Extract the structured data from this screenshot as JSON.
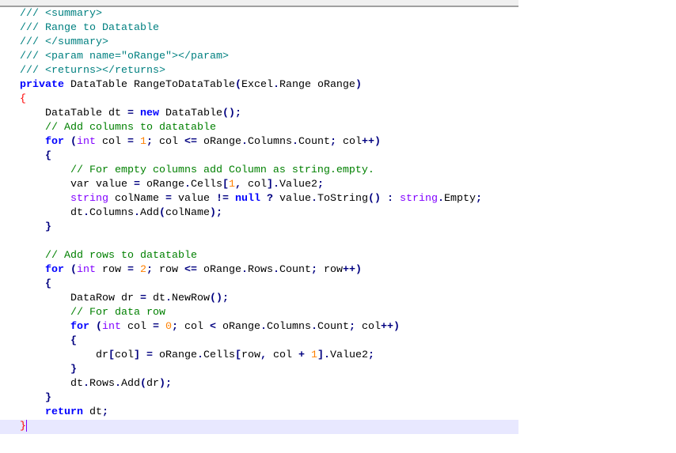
{
  "editor": {
    "current_line": 30,
    "colors": {
      "doc_comment": "#008080",
      "comment": "#008000",
      "keyword": "#0000FF",
      "type": "#8000FF",
      "number": "#FF8000",
      "operator": "#000080",
      "brace_match": "#FF0000",
      "current_line_bg": "#E8E8FF"
    },
    "lines": [
      [
        [
          "/// <summary>",
          "d"
        ]
      ],
      [
        [
          "/// Range to Datatable",
          "d"
        ]
      ],
      [
        [
          "/// </summary>",
          "d"
        ]
      ],
      [
        [
          "/// <param name=\"oRange\"></param>",
          "d"
        ]
      ],
      [
        [
          "/// <returns></returns>",
          "d"
        ]
      ],
      [
        [
          "private",
          "k"
        ],
        [
          " DataTable RangeToDataTable",
          "p"
        ],
        [
          "(",
          "o"
        ],
        [
          "Excel",
          "p"
        ],
        [
          ".",
          "o"
        ],
        [
          "Range oRange",
          "p"
        ],
        [
          ")",
          "o"
        ]
      ],
      [
        [
          "{",
          "b"
        ]
      ],
      [
        [
          "    DataTable dt ",
          "p"
        ],
        [
          "=",
          "o"
        ],
        [
          " ",
          "p"
        ],
        [
          "new",
          "k"
        ],
        [
          " DataTable",
          "p"
        ],
        [
          "();",
          "o"
        ]
      ],
      [
        [
          "    // Add columns to datatable",
          "c"
        ]
      ],
      [
        [
          "    ",
          "p"
        ],
        [
          "for",
          "k"
        ],
        [
          " ",
          "p"
        ],
        [
          "(",
          "o"
        ],
        [
          "int",
          "t"
        ],
        [
          " col ",
          "p"
        ],
        [
          "=",
          "o"
        ],
        [
          " ",
          "p"
        ],
        [
          "1",
          "n"
        ],
        [
          ";",
          "o"
        ],
        [
          " col ",
          "p"
        ],
        [
          "<=",
          "o"
        ],
        [
          " oRange",
          "p"
        ],
        [
          ".",
          "o"
        ],
        [
          "Columns",
          "p"
        ],
        [
          ".",
          "o"
        ],
        [
          "Count",
          "p"
        ],
        [
          ";",
          "o"
        ],
        [
          " col",
          "p"
        ],
        [
          "++)",
          "o"
        ]
      ],
      [
        [
          "    ",
          "p"
        ],
        [
          "{",
          "o"
        ]
      ],
      [
        [
          "        // For empty columns add Column as string.empty.",
          "c"
        ]
      ],
      [
        [
          "        var value ",
          "p"
        ],
        [
          "=",
          "o"
        ],
        [
          " oRange",
          "p"
        ],
        [
          ".",
          "o"
        ],
        [
          "Cells",
          "p"
        ],
        [
          "[",
          "o"
        ],
        [
          "1",
          "n"
        ],
        [
          ",",
          "o"
        ],
        [
          " col",
          "p"
        ],
        [
          "].",
          "o"
        ],
        [
          "Value2",
          "p"
        ],
        [
          ";",
          "o"
        ]
      ],
      [
        [
          "        ",
          "p"
        ],
        [
          "string",
          "t"
        ],
        [
          " colName ",
          "p"
        ],
        [
          "=",
          "o"
        ],
        [
          " value ",
          "p"
        ],
        [
          "!=",
          "o"
        ],
        [
          " ",
          "p"
        ],
        [
          "null",
          "k"
        ],
        [
          " ",
          "p"
        ],
        [
          "?",
          "o"
        ],
        [
          " value",
          "p"
        ],
        [
          ".",
          "o"
        ],
        [
          "ToString",
          "p"
        ],
        [
          "()",
          "o"
        ],
        [
          " ",
          "p"
        ],
        [
          ":",
          "o"
        ],
        [
          " ",
          "p"
        ],
        [
          "string",
          "t"
        ],
        [
          ".",
          "o"
        ],
        [
          "Empty",
          "p"
        ],
        [
          ";",
          "o"
        ]
      ],
      [
        [
          "        dt",
          "p"
        ],
        [
          ".",
          "o"
        ],
        [
          "Columns",
          "p"
        ],
        [
          ".",
          "o"
        ],
        [
          "Add",
          "p"
        ],
        [
          "(",
          "o"
        ],
        [
          "colName",
          "p"
        ],
        [
          ");",
          "o"
        ]
      ],
      [
        [
          "    ",
          "p"
        ],
        [
          "}",
          "o"
        ]
      ],
      [
        [
          "",
          "p"
        ]
      ],
      [
        [
          "    // Add rows to datatable",
          "c"
        ]
      ],
      [
        [
          "    ",
          "p"
        ],
        [
          "for",
          "k"
        ],
        [
          " ",
          "p"
        ],
        [
          "(",
          "o"
        ],
        [
          "int",
          "t"
        ],
        [
          " row ",
          "p"
        ],
        [
          "=",
          "o"
        ],
        [
          " ",
          "p"
        ],
        [
          "2",
          "n"
        ],
        [
          ";",
          "o"
        ],
        [
          " row ",
          "p"
        ],
        [
          "<=",
          "o"
        ],
        [
          " oRange",
          "p"
        ],
        [
          ".",
          "o"
        ],
        [
          "Rows",
          "p"
        ],
        [
          ".",
          "o"
        ],
        [
          "Count",
          "p"
        ],
        [
          ";",
          "o"
        ],
        [
          " row",
          "p"
        ],
        [
          "++)",
          "o"
        ]
      ],
      [
        [
          "    ",
          "p"
        ],
        [
          "{",
          "o"
        ]
      ],
      [
        [
          "        DataRow dr ",
          "p"
        ],
        [
          "=",
          "o"
        ],
        [
          " dt",
          "p"
        ],
        [
          ".",
          "o"
        ],
        [
          "NewRow",
          "p"
        ],
        [
          "();",
          "o"
        ]
      ],
      [
        [
          "        // For data row",
          "c"
        ]
      ],
      [
        [
          "        ",
          "p"
        ],
        [
          "for",
          "k"
        ],
        [
          " ",
          "p"
        ],
        [
          "(",
          "o"
        ],
        [
          "int",
          "t"
        ],
        [
          " col ",
          "p"
        ],
        [
          "=",
          "o"
        ],
        [
          " ",
          "p"
        ],
        [
          "0",
          "n"
        ],
        [
          ";",
          "o"
        ],
        [
          " col ",
          "p"
        ],
        [
          "<",
          "o"
        ],
        [
          " oRange",
          "p"
        ],
        [
          ".",
          "o"
        ],
        [
          "Columns",
          "p"
        ],
        [
          ".",
          "o"
        ],
        [
          "Count",
          "p"
        ],
        [
          ";",
          "o"
        ],
        [
          " col",
          "p"
        ],
        [
          "++)",
          "o"
        ]
      ],
      [
        [
          "        ",
          "p"
        ],
        [
          "{",
          "o"
        ]
      ],
      [
        [
          "            dr",
          "p"
        ],
        [
          "[",
          "o"
        ],
        [
          "col",
          "p"
        ],
        [
          "]",
          "o"
        ],
        [
          " ",
          "p"
        ],
        [
          "=",
          "o"
        ],
        [
          " oRange",
          "p"
        ],
        [
          ".",
          "o"
        ],
        [
          "Cells",
          "p"
        ],
        [
          "[",
          "o"
        ],
        [
          "row",
          "p"
        ],
        [
          ",",
          "o"
        ],
        [
          " col ",
          "p"
        ],
        [
          "+",
          "o"
        ],
        [
          " ",
          "p"
        ],
        [
          "1",
          "n"
        ],
        [
          "].",
          "o"
        ],
        [
          "Value2",
          "p"
        ],
        [
          ";",
          "o"
        ]
      ],
      [
        [
          "        ",
          "p"
        ],
        [
          "}",
          "o"
        ]
      ],
      [
        [
          "        dt",
          "p"
        ],
        [
          ".",
          "o"
        ],
        [
          "Rows",
          "p"
        ],
        [
          ".",
          "o"
        ],
        [
          "Add",
          "p"
        ],
        [
          "(",
          "o"
        ],
        [
          "dr",
          "p"
        ],
        [
          ");",
          "o"
        ]
      ],
      [
        [
          "    ",
          "p"
        ],
        [
          "}",
          "o"
        ]
      ],
      [
        [
          "    ",
          "p"
        ],
        [
          "return",
          "k"
        ],
        [
          " dt",
          "p"
        ],
        [
          ";",
          "o"
        ]
      ],
      [
        [
          "}",
          "b"
        ]
      ]
    ]
  }
}
